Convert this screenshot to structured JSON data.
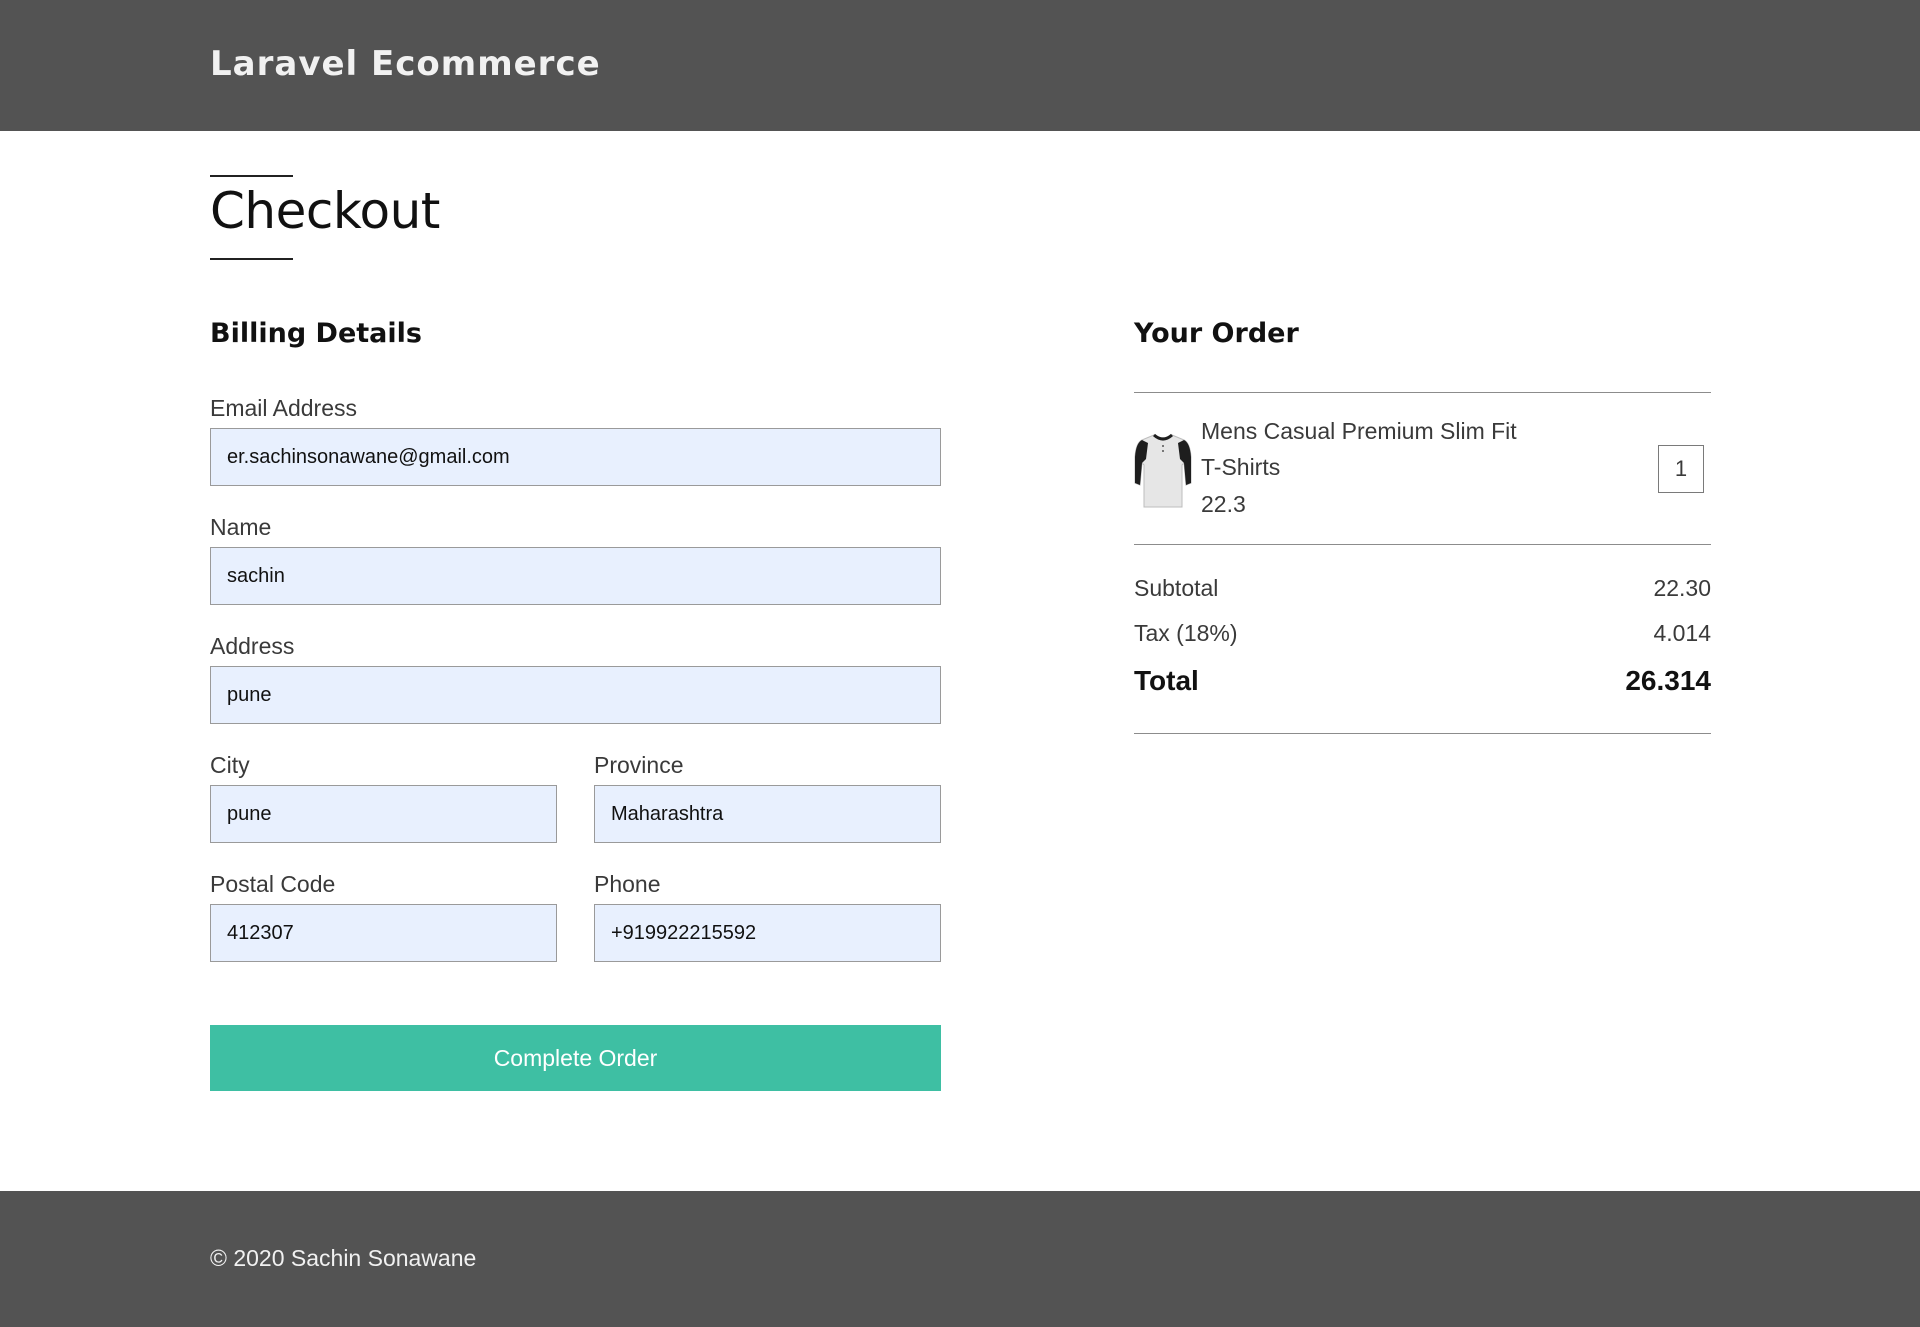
{
  "header": {
    "brand": "Laravel Ecommerce"
  },
  "page": {
    "title": "Checkout"
  },
  "billing": {
    "heading": "Billing Details",
    "email": {
      "label": "Email Address",
      "value": "er.sachinsonawane@gmail.com"
    },
    "name": {
      "label": "Name",
      "value": "sachin"
    },
    "address": {
      "label": "Address",
      "value": "pune"
    },
    "city": {
      "label": "City",
      "value": "pune"
    },
    "province": {
      "label": "Province",
      "value": "Maharashtra"
    },
    "postal_code": {
      "label": "Postal Code",
      "value": "412307"
    },
    "phone": {
      "label": "Phone",
      "value": "+919922215592"
    },
    "submit_label": "Complete Order"
  },
  "order": {
    "heading": "Your Order",
    "items": [
      {
        "name": "Mens Casual Premium Slim Fit T-Shirts",
        "price": "22.3",
        "quantity": "1",
        "image_icon": "tshirt-icon"
      }
    ],
    "subtotal_label": "Subtotal",
    "subtotal_value": "22.30",
    "tax_label": "Tax (18%)",
    "tax_value": "4.014",
    "total_label": "Total",
    "total_value": "26.314"
  },
  "footer": {
    "text": "© 2020 Sachin Sonawane"
  },
  "colors": {
    "header_bg": "#535353",
    "input_bg": "#e8f0fe",
    "accent": "#3ebfa3"
  }
}
